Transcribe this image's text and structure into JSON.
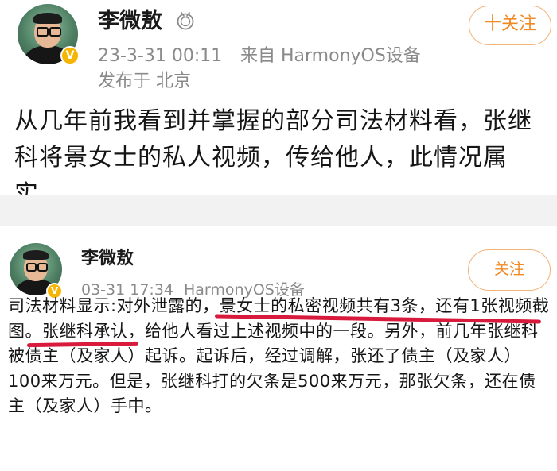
{
  "post1": {
    "author": "李微敖",
    "time": "23-3-31 00:11",
    "source": "来自 HarmonyOS设备",
    "location": "发布于 北京",
    "follow_label": "十关注",
    "text": "从几年前我看到并掌握的部分司法材料看，张继科将景女士的私人视频，传给他人，此情况属实。"
  },
  "post2": {
    "author": "李微敖",
    "time": "03-31 17:34",
    "source": "HarmonyOS设备",
    "follow_label": "关注",
    "text": "司法材料显示:对外泄露的，景女士的私密视频共有3条，还有1张视频截图。张继科承认，给他人看过上述视频中的一段。另外，前几年张继科被债主（及家人）起诉。起诉后，经过调解，张还了债主（及家人）100来万元。但是，张继科打的欠条是500来万元，那张欠条，还在债主（及家人）手中。"
  },
  "colors": {
    "follow_orange": "#f08a24",
    "underline_red": "#d81b3c",
    "verified_gold": "#f6b500",
    "meta_gray": "#8a8a8a"
  },
  "icons": [
    "avatar",
    "verified-badge-icon",
    "medal-icon"
  ]
}
